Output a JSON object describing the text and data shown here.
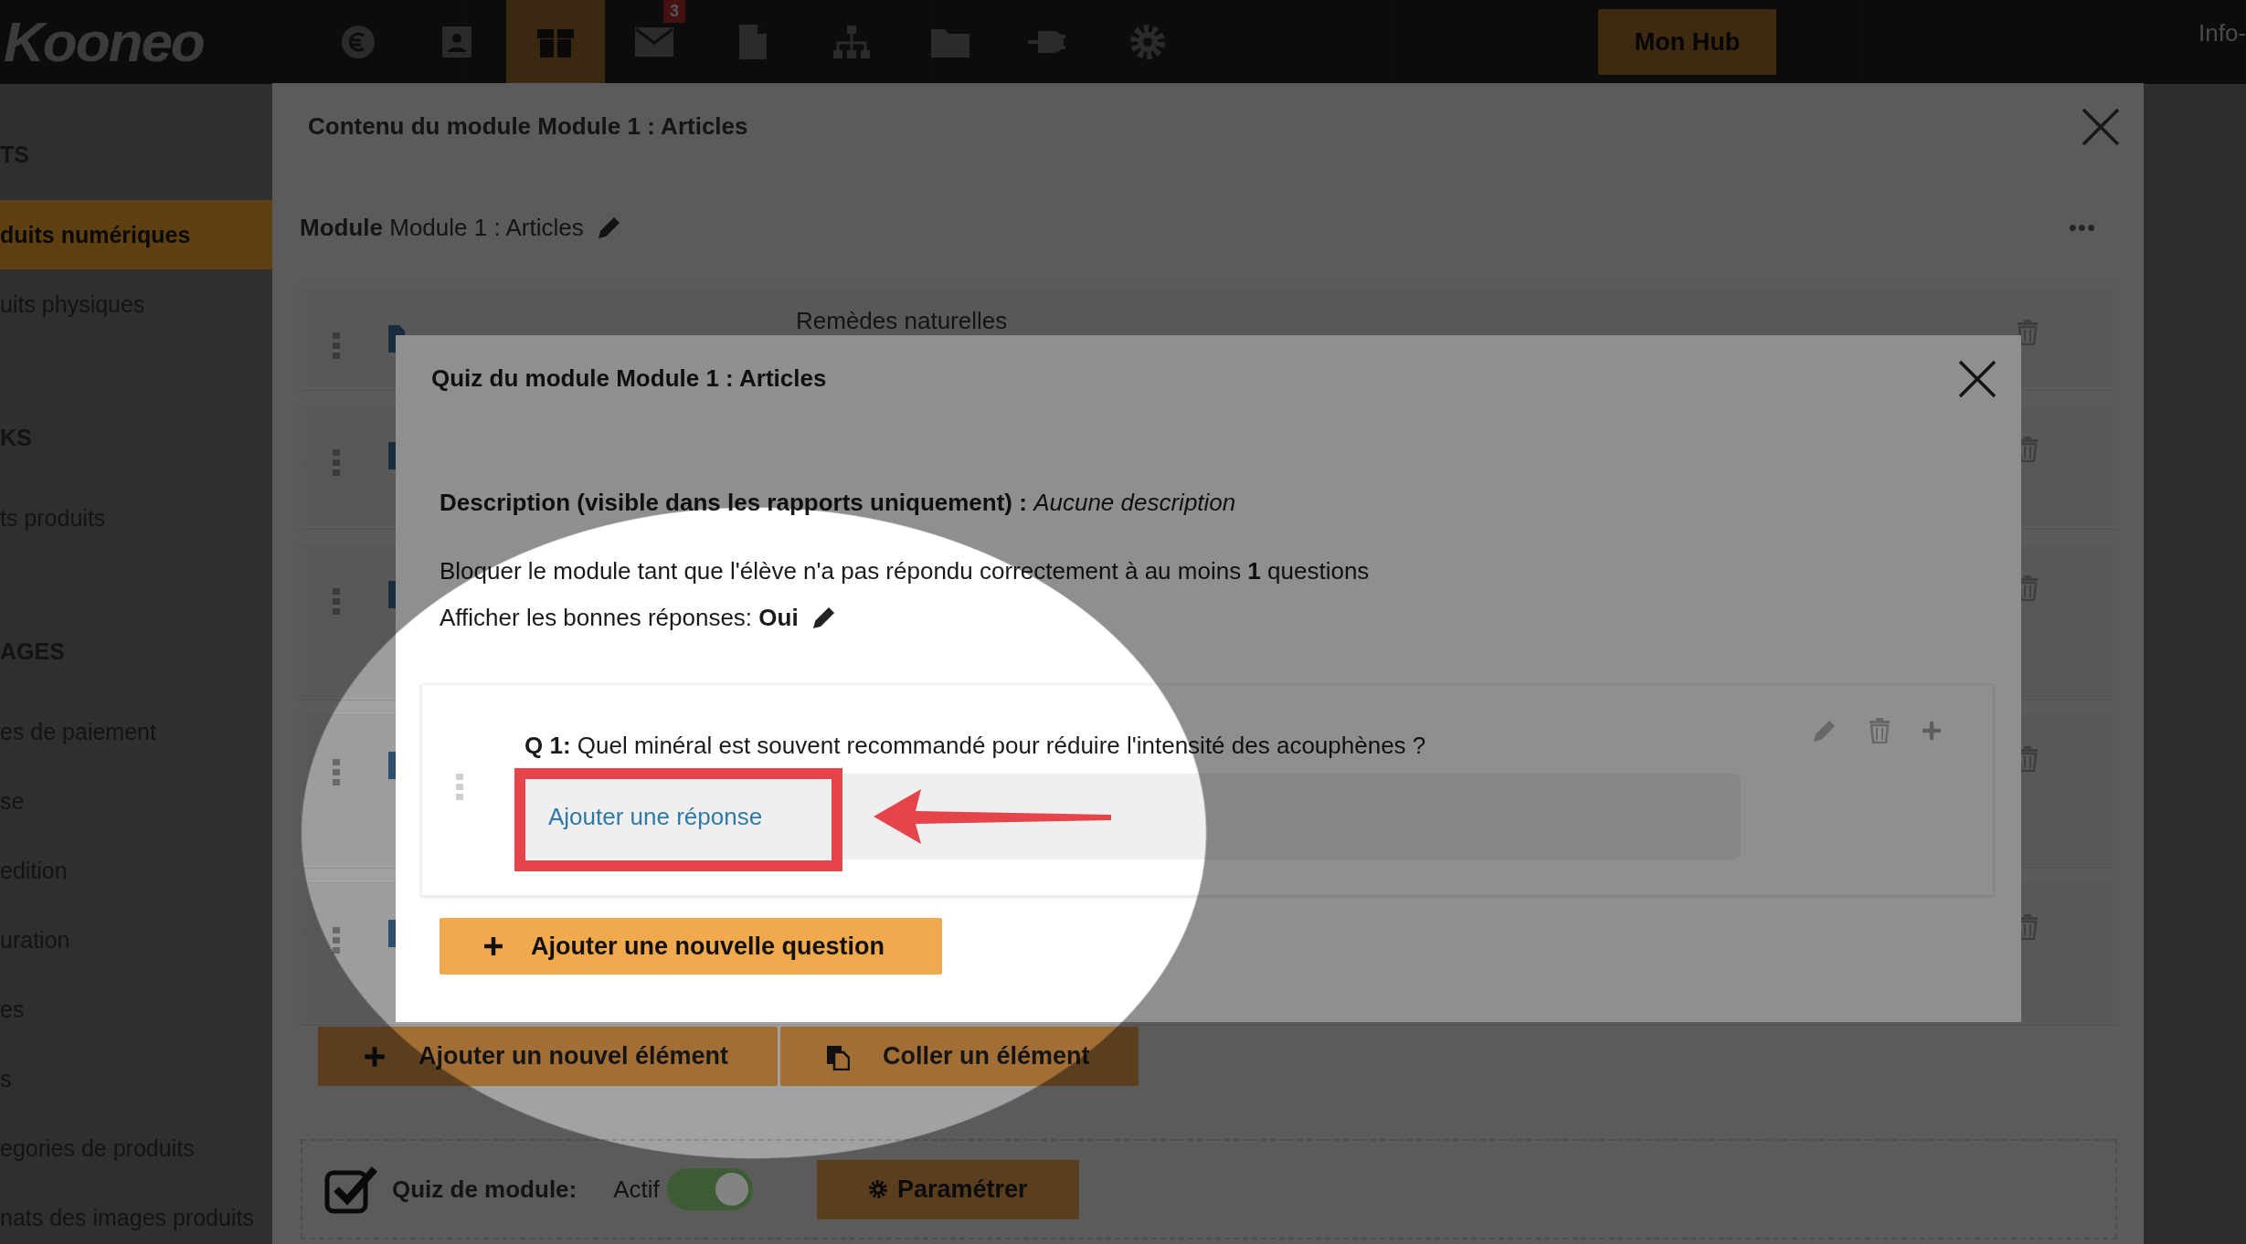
{
  "top_bar": {
    "logo": "Kooneo",
    "nav": [
      {
        "kind": "euro",
        "selected": false
      },
      {
        "kind": "contact",
        "selected": false
      },
      {
        "kind": "box",
        "selected": true
      },
      {
        "kind": "mail",
        "selected": false,
        "badge": "3"
      },
      {
        "kind": "document",
        "selected": false
      },
      {
        "kind": "sitemap",
        "selected": false
      },
      {
        "kind": "folder",
        "selected": false
      },
      {
        "kind": "plug",
        "selected": false
      },
      {
        "kind": "gear",
        "selected": false
      }
    ],
    "hub_button": "Mon Hub",
    "account": "Info-"
  },
  "sidebar": {
    "items": [
      {
        "kind": "header",
        "label": "TS"
      },
      {
        "kind": "item",
        "label": "duits numériques",
        "selected": true
      },
      {
        "kind": "item",
        "label": "uits physiques",
        "selected": false
      },
      {
        "kind": "header",
        "label": "KS"
      },
      {
        "kind": "item",
        "label": "ts produits",
        "selected": false
      },
      {
        "kind": "header",
        "label": "AGES"
      },
      {
        "kind": "item",
        "label": "es de paiement",
        "selected": false
      },
      {
        "kind": "item",
        "label": "se",
        "selected": false
      },
      {
        "kind": "item",
        "label": "edition",
        "selected": false
      },
      {
        "kind": "item",
        "label": "uration",
        "selected": false
      },
      {
        "kind": "item",
        "label": "es",
        "selected": false
      },
      {
        "kind": "item",
        "label": "s",
        "selected": false
      },
      {
        "kind": "item",
        "label": "egories de produits",
        "selected": false
      },
      {
        "kind": "item",
        "label": "nats des images produits",
        "selected": false
      }
    ]
  },
  "content_modal": {
    "title": "Contenu du module Module 1 : Articles",
    "module_label": "Module",
    "module_name": "Module 1 : Articles",
    "more": "•••",
    "rows": [
      {
        "kind": "article",
        "column_2": "Remèdes naturelles"
      },
      {
        "kind": "article"
      },
      {
        "kind": "article"
      },
      {
        "kind": "article"
      },
      {
        "kind": "article"
      }
    ],
    "add_element": "Ajouter un nouvel élément",
    "paste_element": "Coller un élément",
    "quiz": {
      "label": "Quiz de module:",
      "checked": true,
      "toggle_label": "Actif",
      "active": true,
      "settings_button": "Paramétrer"
    }
  },
  "quiz_modal": {
    "title": "Quiz du module Module 1 : Articles",
    "description_label": "Description (visible dans les rapports uniquement) :",
    "description": "Aucune description",
    "block_rule": "Bloquer le module tant que l'élève n'a pas répondu correctement à au moins **1** questions",
    "show_answers_label": "Afficher les bonnes réponses:",
    "show_answers": "Oui",
    "questions": [
      {
        "number": "Q 1:",
        "text": "Quel minéral est souvent recommandé pour réduire l'intensité des acouphènes ?",
        "add_answer": "Ajouter une réponse"
      }
    ],
    "add_question": "Ajouter une nouvelle question"
  }
}
